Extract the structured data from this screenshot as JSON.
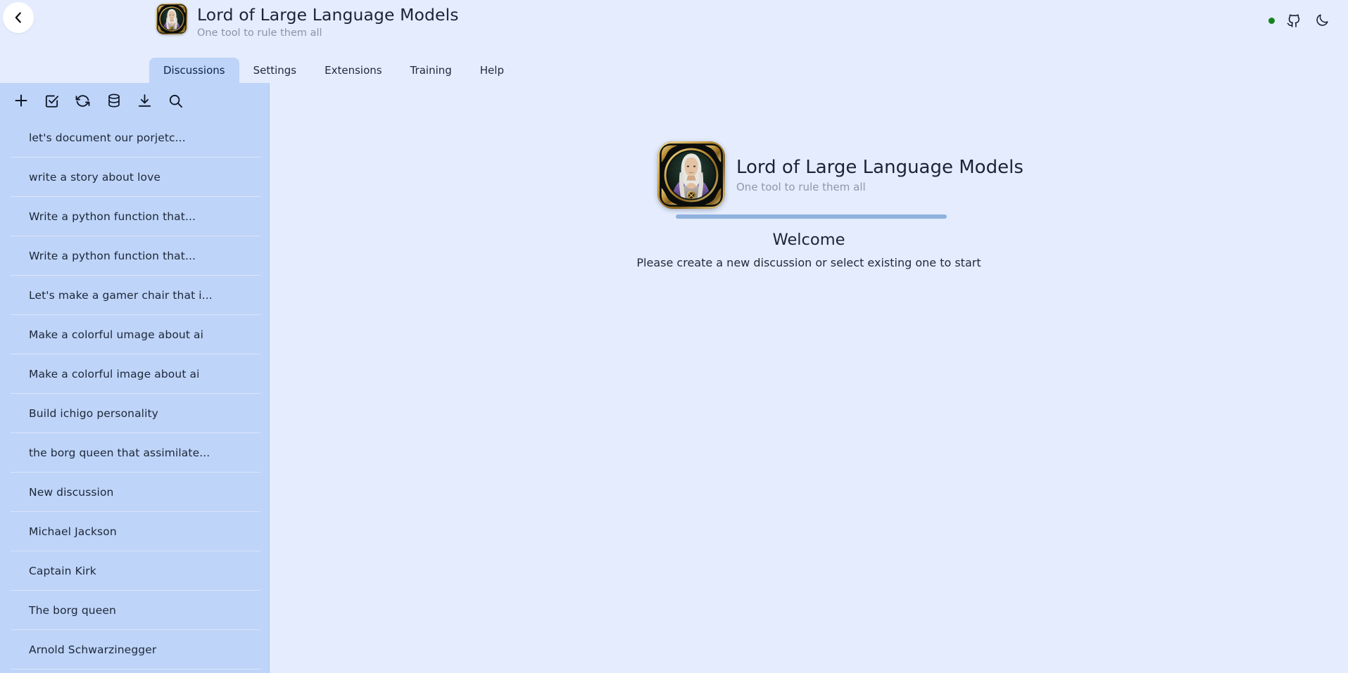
{
  "header": {
    "back_button_icon": "chevron-left-icon",
    "app_title": "Lord of Large Language Models",
    "app_subtitle": "One tool to rule them all",
    "avatar_icon": "app-avatar",
    "status_dot_color": "#17821f",
    "status_dot_icon": "connection-status-dot",
    "github_icon": "github-icon",
    "theme_toggle_icon": "moon-icon"
  },
  "tabs": [
    {
      "label": "Discussions",
      "active": true
    },
    {
      "label": "Settings",
      "active": false
    },
    {
      "label": "Extensions",
      "active": false
    },
    {
      "label": "Training",
      "active": false
    },
    {
      "label": "Help",
      "active": false
    }
  ],
  "sidebar": {
    "toolbar": [
      {
        "icon": "plus-icon",
        "name": "new-discussion-button"
      },
      {
        "icon": "checkbox-check-icon",
        "name": "select-discussions-button"
      },
      {
        "icon": "refresh-icon",
        "name": "reload-discussions-button"
      },
      {
        "icon": "database-icon",
        "name": "database-button"
      },
      {
        "icon": "download-icon",
        "name": "export-discussions-button"
      },
      {
        "icon": "search-icon",
        "name": "search-discussions-button"
      }
    ],
    "discussions": [
      "let's document our porjetc...",
      "write a story about love",
      "Write a python function that...",
      "Write a python function that...",
      "Let's make a gamer chair that i...",
      "Make a colorful umage about ai",
      "Make a colorful image about ai",
      "Build ichigo personality",
      "the borg queen that assimilate...",
      "New discussion",
      "Michael Jackson",
      "Captain Kirk",
      "The borg queen",
      "Arnold Schwarzinegger"
    ]
  },
  "main": {
    "avatar_icon": "app-avatar",
    "title": "Lord of Large Language Models",
    "subtitle": "One tool to rule them all",
    "welcome_heading": "Welcome",
    "welcome_description": "Please create a new discussion or select existing one to start"
  },
  "colors": {
    "page_background": "#e4ecfd",
    "sidebar_background": "#bed4f8",
    "active_tab_background": "#bed4f8",
    "divider": "#8fb2dd",
    "text_primary": "#1b2436",
    "text_muted": "#8b93a4"
  }
}
